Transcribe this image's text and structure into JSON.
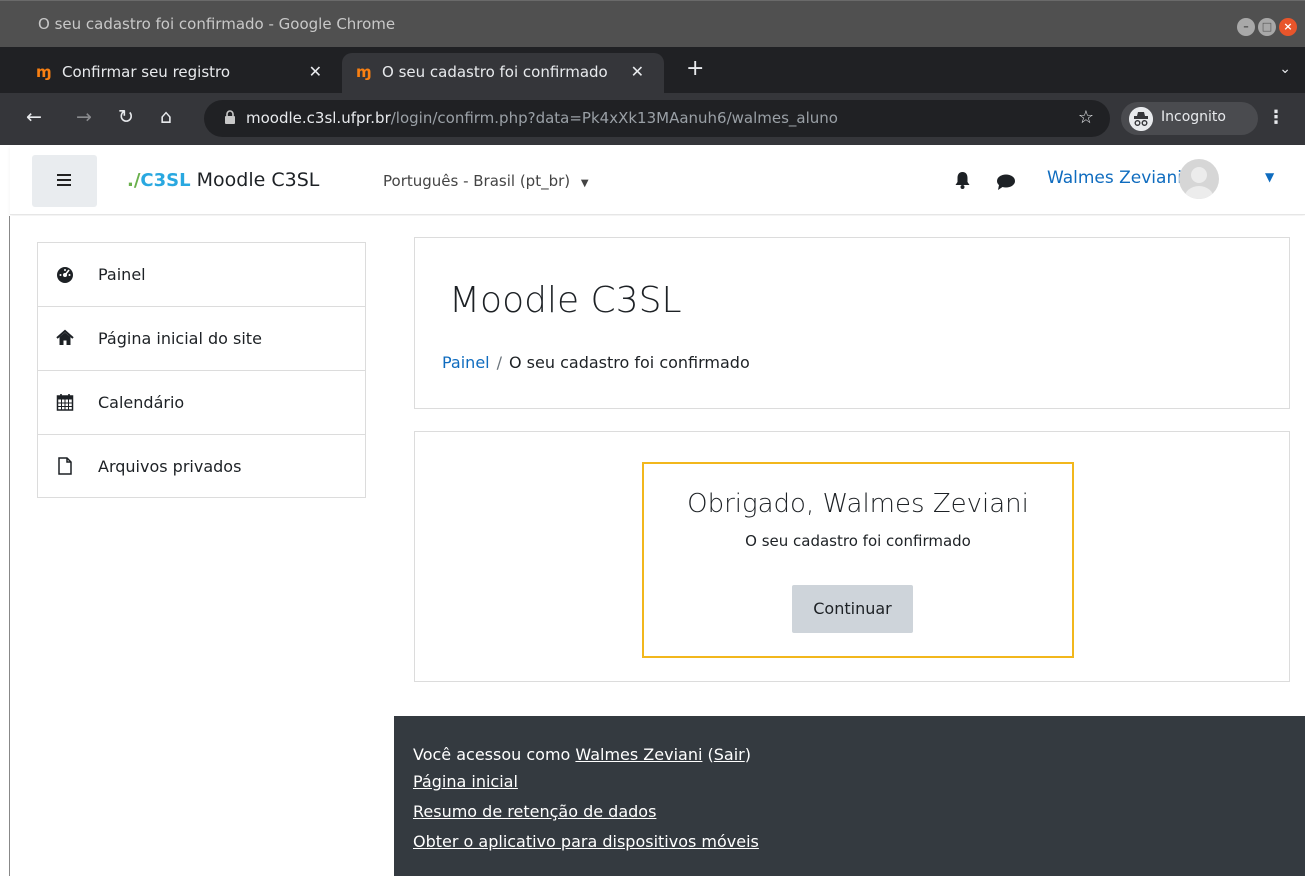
{
  "window": {
    "title": "O seu cadastro foi confirmado - Google Chrome"
  },
  "tabs": [
    {
      "label": "Confirmar seu registro",
      "favicon": "moodle-icon",
      "active": false
    },
    {
      "label": "O seu cadastro foi confirmado",
      "favicon": "moodle-icon",
      "active": true
    }
  ],
  "browser": {
    "url_host": "moodle.c3sl.ufpr.br",
    "url_path": "/login/confirm.php?data=Pk4xXk13MAanuh6/walmes_aluno",
    "incognito_label": "Incognito"
  },
  "navbar": {
    "logo_prefix": "./",
    "logo_text": "C3SL",
    "site_name": "Moodle C3SL",
    "language": "Português - Brasil (pt_br)",
    "user_name": "Walmes Zeviani"
  },
  "sidebar": {
    "items": [
      {
        "label": "Painel",
        "icon": "dashboard-icon"
      },
      {
        "label": "Página inicial do site",
        "icon": "home-icon"
      },
      {
        "label": "Calendário",
        "icon": "calendar-icon"
      },
      {
        "label": "Arquivos privados",
        "icon": "file-icon"
      }
    ]
  },
  "header": {
    "title": "Moodle C3SL",
    "breadcrumb": {
      "link": "Painel",
      "separator": "/",
      "current": "O seu cadastro foi confirmado"
    }
  },
  "notice": {
    "heading": "Obrigado, Walmes Zeviani",
    "message": "O seu cadastro foi confirmado",
    "button": "Continuar"
  },
  "footer": {
    "logged_in_prefix": "Você acessou como",
    "logged_in_user": "Walmes Zeviani",
    "logout": "Sair",
    "home": "Página inicial",
    "data_retention": "Resumo de retenção de dados",
    "mobile_app": "Obter o aplicativo para dispositivos móveis"
  },
  "colors": {
    "link": "#0f6cbf",
    "notice_border": "#f2b71c",
    "footer_bg": "#343a40"
  }
}
